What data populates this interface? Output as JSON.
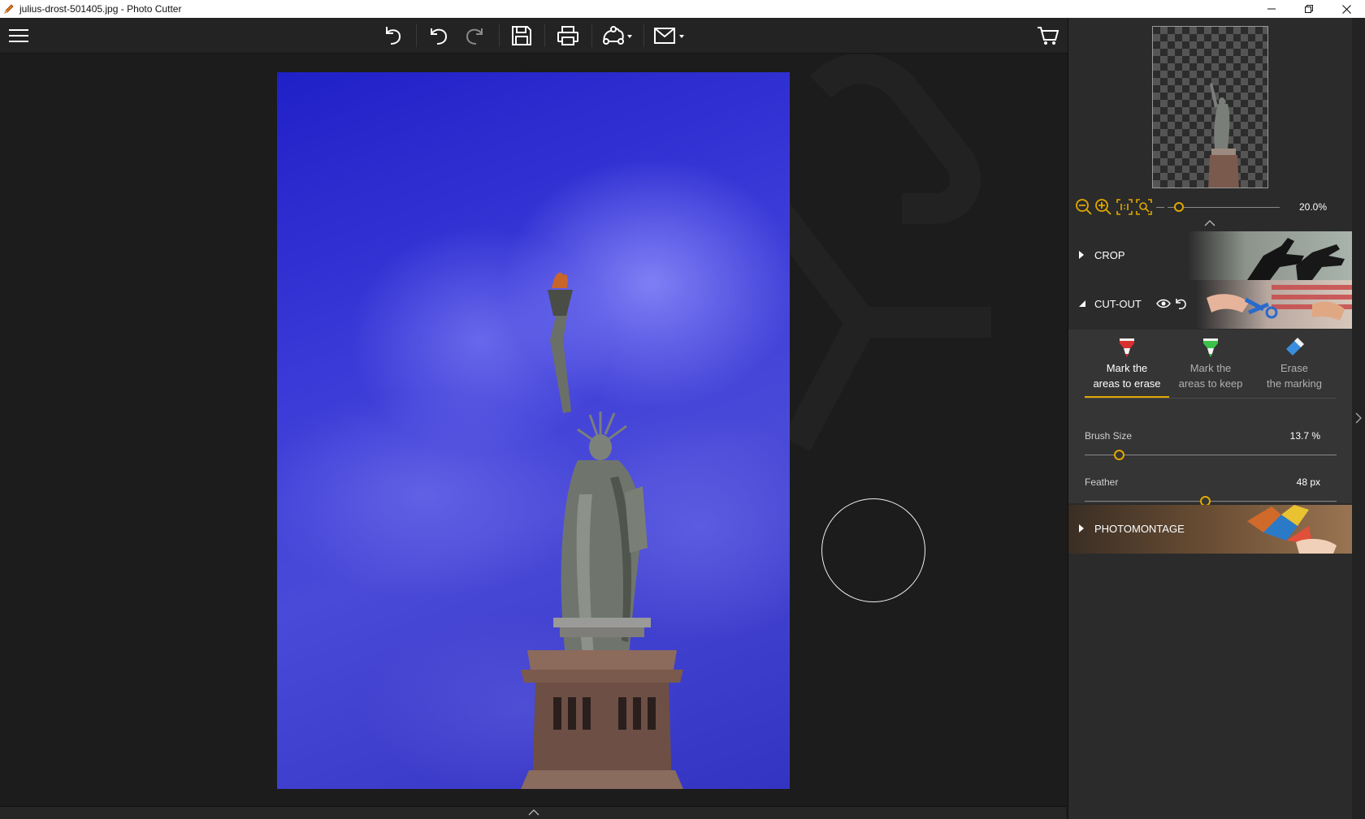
{
  "window": {
    "title": "julius-drost-501405.jpg - Photo Cutter"
  },
  "toolbar": {
    "buttons": [
      "menu-icon",
      "undo-all-icon",
      "undo-icon",
      "redo-icon",
      "save-icon",
      "print-icon",
      "share-icon",
      "email-icon",
      "cart-icon"
    ]
  },
  "navigator": {
    "zoom_value": "20.0%",
    "zoom_level": 0.2
  },
  "sections": {
    "crop": "CROP",
    "cutout": "CUT-OUT",
    "photomontage": "PHOTOMONTAGE"
  },
  "cutout_tools": [
    {
      "line1": "Mark the",
      "line2": "areas to erase",
      "active": true
    },
    {
      "line1": "Mark the",
      "line2": "areas to keep",
      "active": false
    },
    {
      "line1": "Erase",
      "line2": "the marking",
      "active": false
    }
  ],
  "params": {
    "brush_size_label": "Brush Size",
    "brush_size_value": "13.7 %",
    "brush_size_fraction": 0.137,
    "feather_label": "Feather",
    "feather_value": "48 px",
    "feather_fraction": 0.48
  },
  "colors": {
    "accent": "#e0a800",
    "panel": "#2b2b2b",
    "sky": "#3a3ad8"
  }
}
